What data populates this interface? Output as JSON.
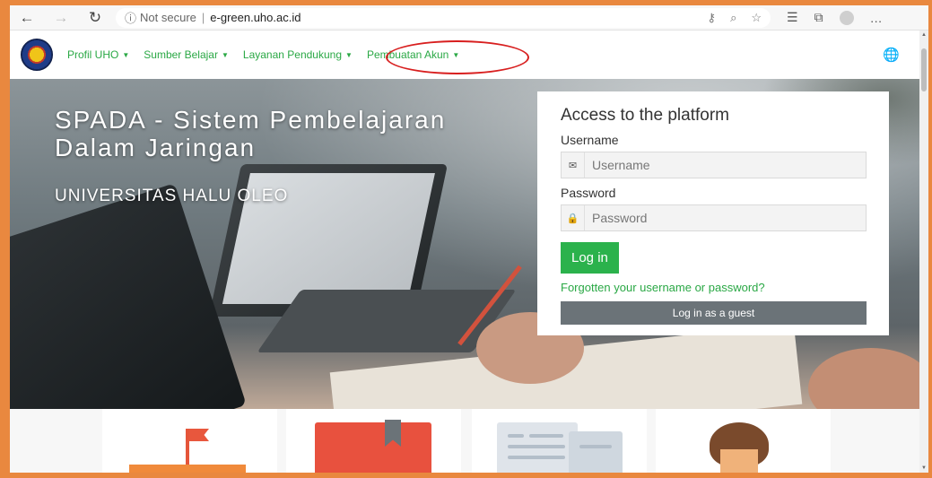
{
  "browser": {
    "security_label": "Not secure",
    "separator": "|",
    "url": "e-green.uho.ac.id",
    "more_label": "…"
  },
  "nav": {
    "items": [
      {
        "label": "Profil UHO"
      },
      {
        "label": "Sumber Belajar"
      },
      {
        "label": "Layanan Pendukung"
      },
      {
        "label": "Pembuatan Akun"
      }
    ],
    "highlight_color": "#d81f1f",
    "accent_color": "#2aa845"
  },
  "hero": {
    "title": "SPADA - Sistem Pembelajaran Dalam Jaringan",
    "subtitle": "UNIVERSITAS HALU OLEO"
  },
  "login": {
    "heading": "Access to the platform",
    "username_label": "Username",
    "username_placeholder": "Username",
    "password_label": "Password",
    "password_placeholder": "Password",
    "login_button": "Log in",
    "forgot_link": "Forgotten your username or password?",
    "guest_button": "Log in as a guest",
    "button_color": "#2bb24c",
    "guest_color": "#6b7378"
  },
  "icons": {
    "back": "arrow-left-icon",
    "forward": "arrow-right-icon",
    "refresh": "refresh-icon",
    "info": "info-icon",
    "key": "key-icon",
    "zoom": "zoom-icon",
    "favorite": "star-icon",
    "favorites_list": "favorites-list-icon",
    "collections": "collections-icon",
    "profile": "profile-icon",
    "language": "globe-icon",
    "envelope": "envelope-icon",
    "lock": "lock-icon"
  },
  "frame_color": "#e9883f"
}
